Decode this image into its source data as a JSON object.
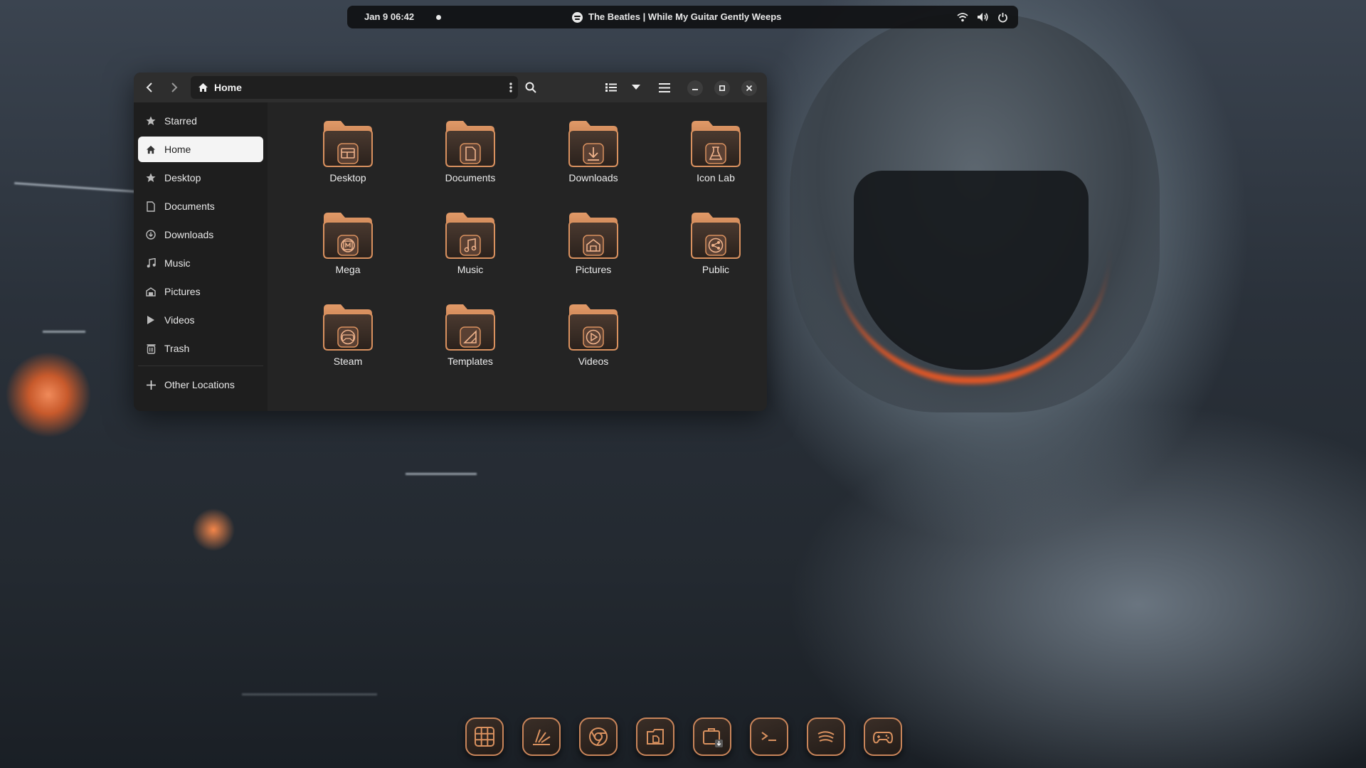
{
  "colors": {
    "accent": "#d9915f",
    "folder": "#c47a4a",
    "topbar_bg": "#111214",
    "window_bg": "#242424",
    "sidebar_bg": "#1e1e1e"
  },
  "topbar": {
    "clock": "Jan 9  06:42",
    "media_title": "The Beatles | While My Guitar Gently Weeps",
    "icons": [
      "wifi-icon",
      "volume-icon",
      "power-icon"
    ]
  },
  "window": {
    "path": "Home",
    "sidebar": {
      "items": [
        {
          "label": "Starred",
          "icon": "star-icon"
        },
        {
          "label": "Home",
          "icon": "home-icon",
          "active": true
        },
        {
          "label": "Desktop",
          "icon": "star-icon"
        },
        {
          "label": "Documents",
          "icon": "document-icon"
        },
        {
          "label": "Downloads",
          "icon": "download-icon"
        },
        {
          "label": "Music",
          "icon": "music-icon"
        },
        {
          "label": "Pictures",
          "icon": "pictures-icon"
        },
        {
          "label": "Videos",
          "icon": "play-icon"
        },
        {
          "label": "Trash",
          "icon": "trash-icon"
        }
      ],
      "other_locations": "Other Locations"
    },
    "folders": [
      {
        "name": "Desktop",
        "emblem": "desktop"
      },
      {
        "name": "Documents",
        "emblem": "document"
      },
      {
        "name": "Downloads",
        "emblem": "download"
      },
      {
        "name": "Icon Lab",
        "emblem": "flask"
      },
      {
        "name": "Mega",
        "emblem": "mega"
      },
      {
        "name": "Music",
        "emblem": "music"
      },
      {
        "name": "Pictures",
        "emblem": "pictures"
      },
      {
        "name": "Public",
        "emblem": "share"
      },
      {
        "name": "Steam",
        "emblem": "gamepad"
      },
      {
        "name": "Templates",
        "emblem": "template"
      },
      {
        "name": "Videos",
        "emblem": "play"
      }
    ]
  },
  "dock": {
    "apps": [
      "app-grid-icon",
      "drawing-app-icon",
      "browser-icon",
      "files-icon",
      "software-store-icon",
      "terminal-icon",
      "music-player-icon",
      "games-icon"
    ]
  }
}
